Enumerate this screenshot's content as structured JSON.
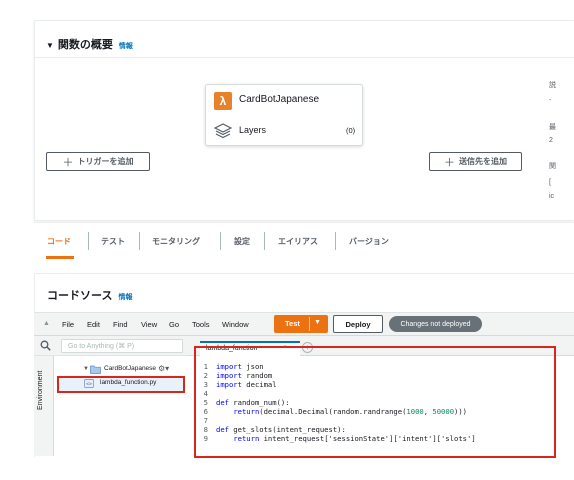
{
  "overview": {
    "title": "関数の概要",
    "info": "情報",
    "function_name": "CardBotJapanese",
    "layers_label": "Layers",
    "layers_count": "(0)",
    "add_trigger": "トリガーを追加",
    "add_destination": "送信先を追加",
    "side_fragments": [
      "説",
      "-",
      "最",
      "2",
      "関",
      "[",
      "ic"
    ]
  },
  "tabs": [
    {
      "label": "コード",
      "active": true
    },
    {
      "label": "テスト",
      "active": false
    },
    {
      "label": "モニタリング",
      "active": false
    },
    {
      "label": "設定",
      "active": false
    },
    {
      "label": "エイリアス",
      "active": false
    },
    {
      "label": "バージョン",
      "active": false
    }
  ],
  "code_source": {
    "title": "コードソース",
    "info": "情報"
  },
  "ide": {
    "menu": [
      "File",
      "Edit",
      "Find",
      "View",
      "Go",
      "Tools",
      "Window"
    ],
    "test_label": "Test",
    "deploy_label": "Deploy",
    "status_badge": "Changes not deployed",
    "search_placeholder": "Go to Anything (⌘ P)",
    "environment_label": "Environment",
    "folder_name": "CardBotJapanese",
    "file_name": "lambda_function.py",
    "editor_tab": "lambda_function",
    "code_lines": [
      "import json",
      "import random",
      "import decimal",
      "",
      "def random_num():",
      "    return(decimal.Decimal(random.randrange(1000, 50000)))",
      "",
      "def get_slots(intent_request):",
      "    return intent_request['sessionState']['intent']['slots']"
    ]
  },
  "colors": {
    "accent": "#ec7211",
    "highlight_border": "#d8261c",
    "link": "#0073bb",
    "badge": "#687078"
  }
}
